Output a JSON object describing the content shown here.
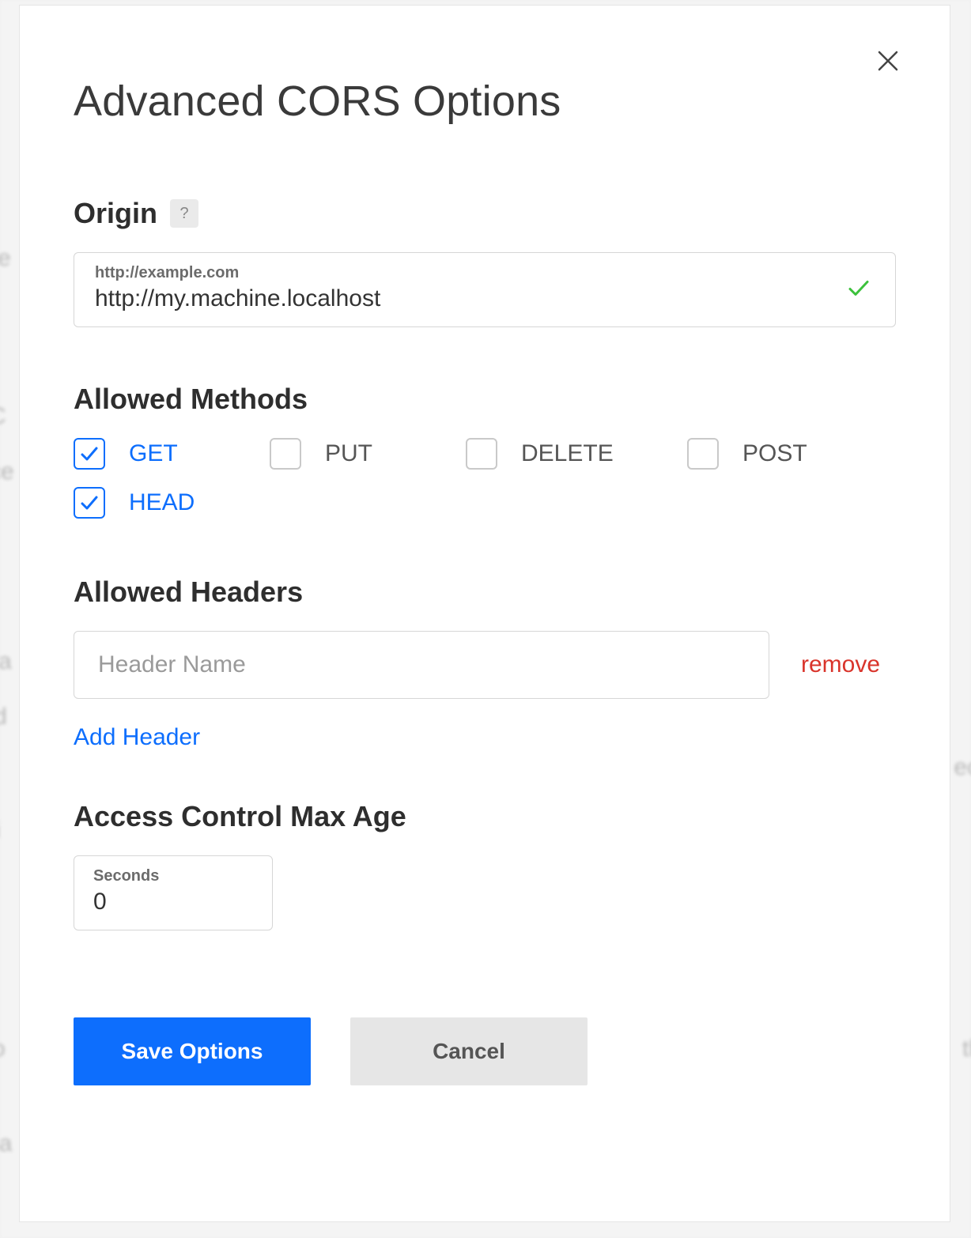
{
  "modal": {
    "title": "Advanced CORS Options",
    "origin": {
      "label": "Origin",
      "placeholder": "http://example.com",
      "value": "http://my.machine.localhost",
      "valid": true
    },
    "methods": {
      "label": "Allowed Methods",
      "items": [
        {
          "name": "GET",
          "checked": true
        },
        {
          "name": "PUT",
          "checked": false
        },
        {
          "name": "DELETE",
          "checked": false
        },
        {
          "name": "POST",
          "checked": false
        },
        {
          "name": "HEAD",
          "checked": true
        }
      ]
    },
    "headers": {
      "label": "Allowed Headers",
      "rows": [
        {
          "value": "",
          "placeholder": "Header Name"
        }
      ],
      "remove_label": "remove",
      "add_label": "Add Header"
    },
    "maxage": {
      "label": "Access Control Max Age",
      "unit_label": "Seconds",
      "value": "0"
    },
    "buttons": {
      "save": "Save Options",
      "cancel": "Cancel"
    },
    "help_symbol": "?"
  }
}
